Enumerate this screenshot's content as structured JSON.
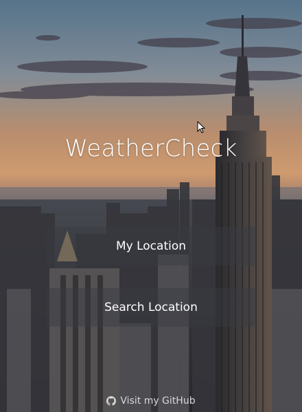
{
  "app": {
    "title": "WeatherCheck"
  },
  "menu": {
    "my_location_label": "My Location",
    "search_location_label": "Search Location"
  },
  "footer": {
    "link_label": "Visit my GitHub",
    "icon": "github-icon"
  },
  "colors": {
    "text": "#ffffff",
    "button_bg": "rgba(58,60,66,0.45)",
    "footer_text": "#d8d8d8"
  }
}
